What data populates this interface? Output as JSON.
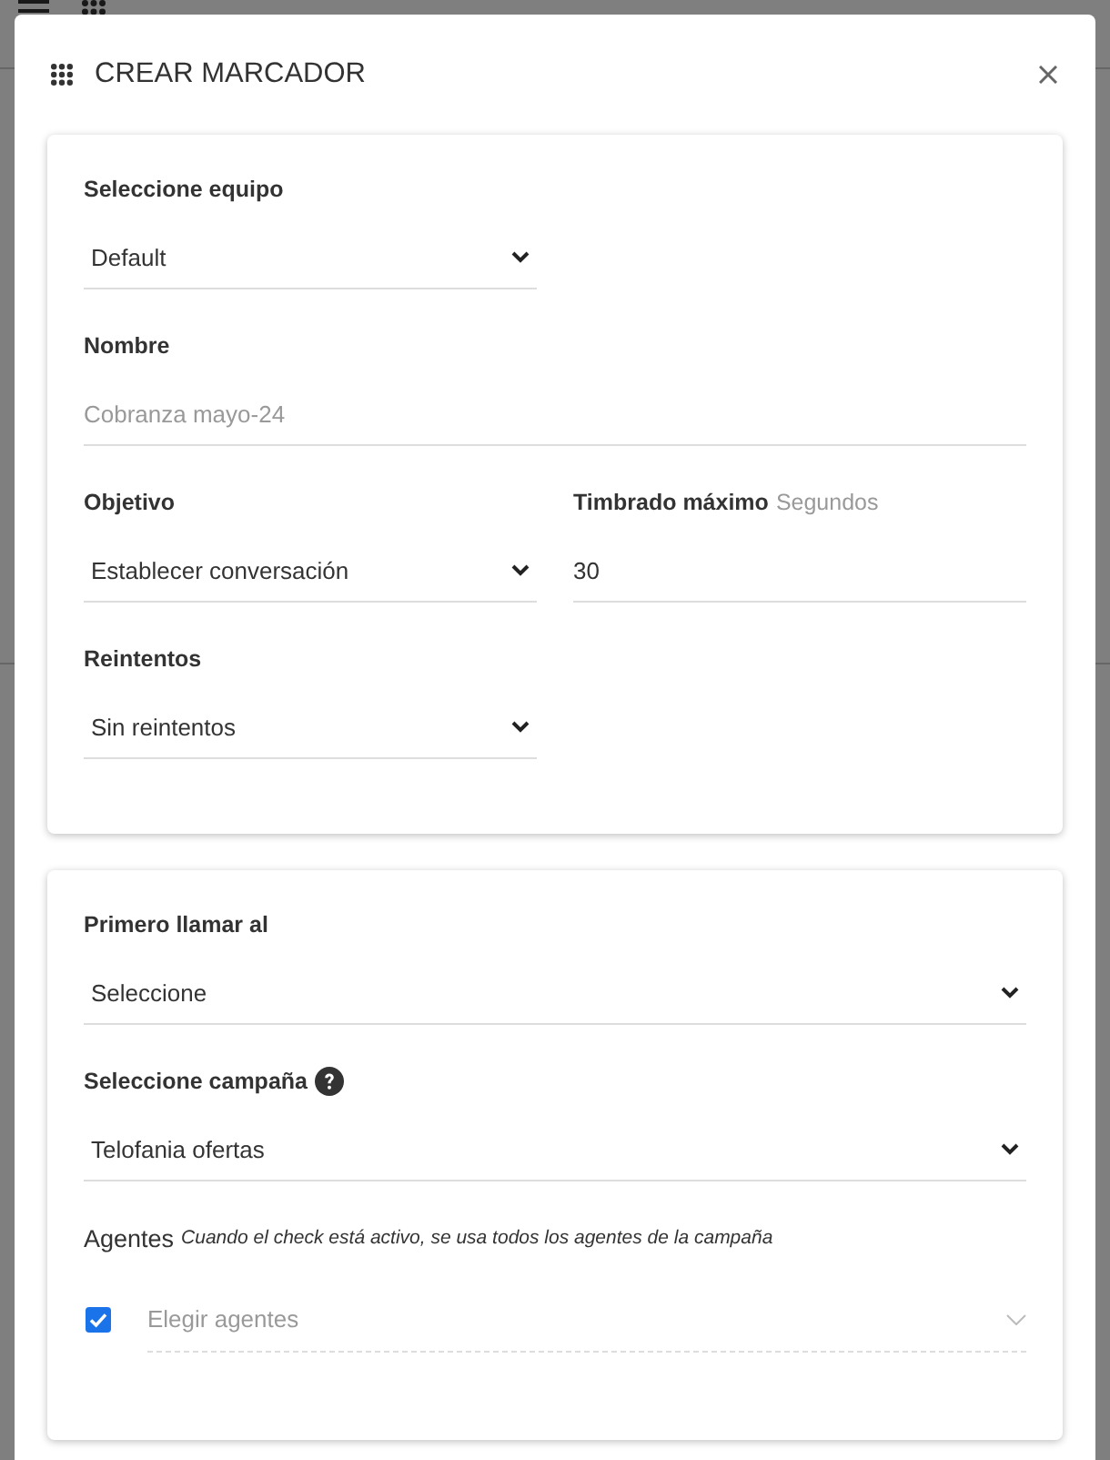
{
  "dialog": {
    "title": "CREAR MARCADOR"
  },
  "sections": [
    {
      "rows": [
        [
          {
            "kind": "select",
            "label": "Seleccione equipo",
            "value": "Default"
          }
        ],
        [
          {
            "kind": "text",
            "label": "Nombre",
            "placeholder": "Cobranza mayo-24"
          }
        ],
        [
          {
            "kind": "select",
            "label": "Objetivo",
            "value": "Establecer conversación"
          },
          {
            "kind": "text",
            "label": "Timbrado máximo",
            "hint": "Segundos",
            "value": "30"
          }
        ],
        [
          {
            "kind": "select",
            "label": "Reintentos",
            "value": "Sin reintentos"
          }
        ]
      ]
    },
    {
      "rows": [
        [
          {
            "kind": "select",
            "label": "Primero llamar al",
            "value": "Seleccione"
          }
        ],
        [
          {
            "kind": "select",
            "label": "Seleccione campaña",
            "help": true,
            "value": "Telofania ofertas"
          }
        ],
        [
          {
            "kind": "agents",
            "label": "Agentes",
            "note": "Cuando el check está activo, se usa todos los agentes de la campaña",
            "checked": true,
            "placeholder": "Elegir agentes"
          }
        ]
      ]
    }
  ]
}
